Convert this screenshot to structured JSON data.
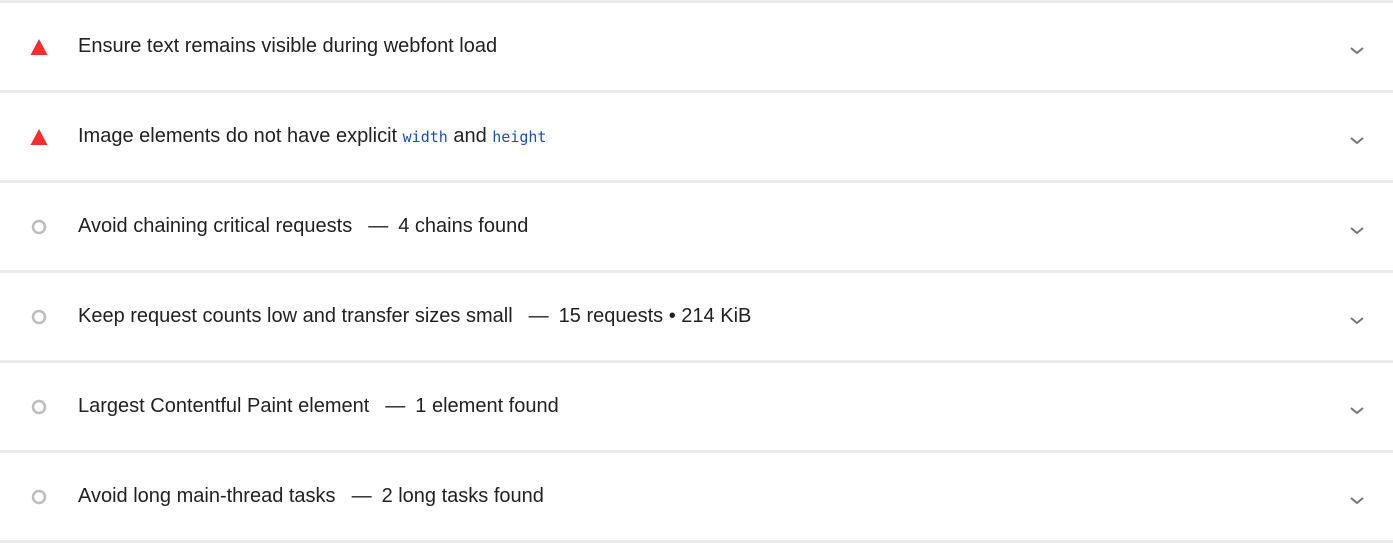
{
  "colors": {
    "fail": "#f22e2e",
    "informative": "#bdbdbd",
    "code": "#1a4fb3",
    "divider": "#ebebeb"
  },
  "audits": [
    {
      "status": "fail",
      "icon": "red-triangle-icon",
      "title": "Ensure text remains visible during webfont load",
      "display_value": ""
    },
    {
      "status": "fail",
      "icon": "red-triangle-icon",
      "title_parts": [
        "Image elements do not have explicit ",
        "width",
        " and ",
        "height"
      ],
      "display_value": ""
    },
    {
      "status": "informative",
      "icon": "gray-circle-icon",
      "title": "Avoid chaining critical requests",
      "display_value": "4 chains found"
    },
    {
      "status": "informative",
      "icon": "gray-circle-icon",
      "title": "Keep request counts low and transfer sizes small",
      "display_value": "15 requests • 214 KiB"
    },
    {
      "status": "informative",
      "icon": "gray-circle-icon",
      "title": "Largest Contentful Paint element",
      "display_value": "1 element found"
    },
    {
      "status": "informative",
      "icon": "gray-circle-icon",
      "title": "Avoid long main-thread tasks",
      "display_value": "2 long tasks found"
    }
  ]
}
